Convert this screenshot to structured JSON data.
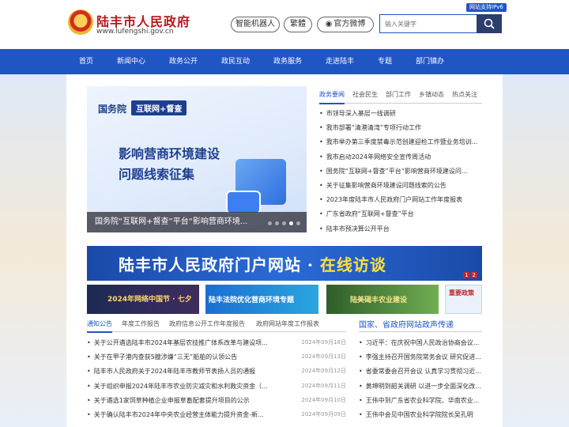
{
  "header": {
    "site_name": "陆丰市人民政府",
    "site_url": "www.lufengshi.gov.cn",
    "robot_btn": "智能机器人",
    "trad_btn": "繁體",
    "weibo_btn": "官方微博",
    "ipv6_badge": "网站支持IPv6",
    "search_placeholder": "输入关键字"
  },
  "nav": [
    "首页",
    "新闻中心",
    "政务公开",
    "政民互动",
    "政务服务",
    "走进陆丰",
    "专题",
    "部门镇办"
  ],
  "slider": {
    "brand": "国务院",
    "tag": "互联网+督查",
    "title_line1": "影响营商环境建设",
    "title_line2": "问题线索征集",
    "caption": "国务院“互联网+督查”平台“影响营商环境...",
    "page_count": 5,
    "active_page": 4
  },
  "news_tabs": [
    "政务要闻",
    "社会民生",
    "部门工作",
    "乡镇动态",
    "热点关注"
  ],
  "news_items": [
    "市领导深入基层一线调研",
    "我市部署“清港清湾”专项行动工作",
    "我市举办第三季度禁毒示范创建迎检工作暨业务培训...",
    "我市启动2024年网络安全宣传周活动",
    "国务院“互联网+督查”平台“影响营商环境建设问...",
    "关于征集影响营商环境建设问题线索的公告",
    "2023年度陆丰市人民政府门户网站工作年度报表",
    "广东省政府“互联网+督查”平台",
    "陆丰市预决算公开平台"
  ],
  "banner": {
    "text_main": "陆丰市人民政府门户网站 · ",
    "text_highlight": "在线访谈",
    "pages": [
      "1",
      "2"
    ]
  },
  "thumbs": {
    "t1": "2024年网络中国节 · 七夕",
    "t2": "陆丰法院优化营商环境专题",
    "t3": "陆美碣丰农业建设",
    "t4": "重要政策"
  },
  "notice_tabs": [
    "通知公告",
    "年度工作报告",
    "政府信息公开工作年度报告",
    "政府网站年度工作报表"
  ],
  "notices": [
    {
      "title": "关于公开遴选陆丰市2024年基层农技推广体系改革与建设项...",
      "date": "2024年09月18日"
    },
    {
      "title": "关于在甲子港内查获5艘涉嫌“三无”船舶的认领公告",
      "date": "2024年09月13日"
    },
    {
      "title": "陆丰市人民政府关于2024年陆丰市教师节表扬人员的通报",
      "date": "2024年09月12日"
    },
    {
      "title": "关于组织申报2024年陆丰市农业防灾减灾和水利救灾资金（...",
      "date": "2024年09月11日"
    },
    {
      "title": "关于遴选1家饲草种植企业申报草畜配套提升项目的公示",
      "date": "2024年09月10日"
    },
    {
      "title": "关于确认陆丰市2024年中央农业经营主体能力提升资金-新...",
      "date": "2024年09月09日"
    }
  ],
  "right_section": {
    "heading": "国家、省政府网站政声传递",
    "items": [
      "习近平：在庆祝中国人民政治协商会议...",
      "李强主持召开国务院常务会议 研究促进...",
      "省委常委会召开会议 认真学习贯彻习近...",
      "黄坤明到韶关调研 以进一步全面深化改...",
      "王伟中到广东省农业科学院、华南农业...",
      "王伟中会见中国农业科学院院长吴孔明"
    ]
  },
  "colors": {
    "nav_blue": "#2055c4",
    "brand_red": "#b8171c"
  }
}
